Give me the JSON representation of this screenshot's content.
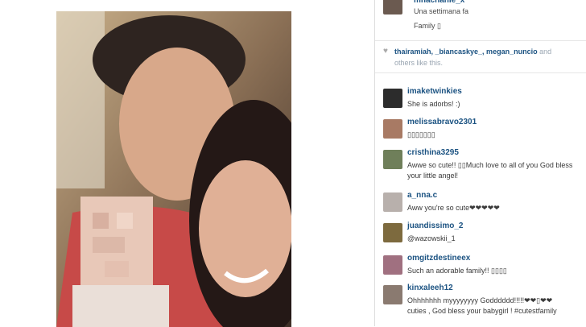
{
  "post": {
    "author": "mnachanie_x",
    "time": "Una settimana fa",
    "caption": "Family ▯"
  },
  "likes": {
    "names": "thairamiah, _biancaskye_, megan_nuncio",
    "suffix": " and",
    "others": "others like this."
  },
  "comments": [
    {
      "user": "imaketwinkies",
      "text": "She is adorbs! :)",
      "text2": ""
    },
    {
      "user": "melissabravo2301",
      "text": "▯▯▯▯▯▯▯",
      "text2": ""
    },
    {
      "user": "cristhina3295",
      "text": "Awwe so cute!! ▯▯Much love to all of you God bless",
      "text2": "your little angel!"
    },
    {
      "user": "a_nna.c",
      "text": "Aww you're so cute❤❤❤❤❤",
      "text2": ""
    },
    {
      "user": "juandissimo_2",
      "text": "@wazowskii_1",
      "text2": ""
    },
    {
      "user": "omgitzdestineex",
      "text": "Such an adorable family!! ▯▯▯▯",
      "text2": ""
    },
    {
      "user": "kinxaleeh12",
      "text": "Ohhhhhhh myyyyyyyy Godddddd!!!!!❤❤▯❤❤",
      "text2": "cuties , God bless your babygirl ! #cutestfamily"
    }
  ],
  "colors": {
    "username": "#1c5382",
    "likes_text": "#9aa6b2",
    "text": "#3a3a3a"
  }
}
